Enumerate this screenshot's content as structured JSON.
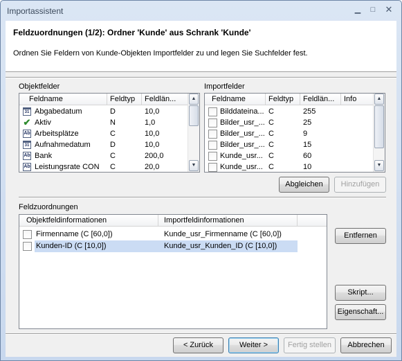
{
  "window": {
    "title": "Importassistent",
    "minimize_icon": "minimize-icon",
    "maximize_icon": "maximize-icon",
    "close_icon": "close-icon"
  },
  "header": {
    "title": "Feldzuordnungen (1/2): Ordner 'Kunde' aus Schrank 'Kunde'",
    "subtitle": "Ordnen Sie Feldern von Kunde-Objekten Importfelder zu und legen Sie Suchfelder fest."
  },
  "objektfelder": {
    "label": "Objektfelder",
    "columns": [
      "Feldname",
      "Feldtyp",
      "Feldlän..."
    ],
    "rows": [
      {
        "icon": "calendar-icon",
        "name": "Abgabedatum",
        "type": "D",
        "length": "10,0"
      },
      {
        "icon": "checkmark-icon",
        "name": "Aktiv",
        "type": "N",
        "length": "1,0"
      },
      {
        "icon": "text-field-icon",
        "name": "Arbeitsplätze",
        "type": "C",
        "length": "10,0"
      },
      {
        "icon": "calendar-icon",
        "name": "Aufnahmedatum",
        "type": "D",
        "length": "10,0"
      },
      {
        "icon": "text-field-icon",
        "name": "Bank",
        "type": "C",
        "length": "200,0"
      },
      {
        "icon": "text-field-icon",
        "name": "Leistungsrate CON",
        "type": "C",
        "length": "20,0"
      }
    ]
  },
  "importfelder": {
    "label": "Importfelder",
    "columns": [
      "Feldname",
      "Feldtyp",
      "Feldlän...",
      "Info"
    ],
    "rows": [
      {
        "name": "Bilddateina...",
        "type": "C",
        "length": "255"
      },
      {
        "name": "Bilder_usr_...",
        "type": "C",
        "length": "25"
      },
      {
        "name": "Bilder_usr_...",
        "type": "C",
        "length": "9"
      },
      {
        "name": "Bilder_usr_...",
        "type": "C",
        "length": "15"
      },
      {
        "name": "Kunde_usr...",
        "type": "C",
        "length": "60"
      },
      {
        "name": "Kunde_usr...",
        "type": "C",
        "length": "10"
      }
    ]
  },
  "buttons": {
    "abgleichen": "Abgleichen",
    "hinzufuegen": "Hinzufügen",
    "entfernen": "Entfernen",
    "skript": "Skript...",
    "eigenschaften": "Eigenschaft...",
    "zurueck": "< Zurück",
    "weiter": "Weiter >",
    "fertig": "Fertig stellen",
    "abbrechen": "Abbrechen"
  },
  "feldzuordnungen": {
    "label": "Feldzuordnungen",
    "columns": [
      "Objektfeldinformationen",
      "Importfeldinformationen"
    ],
    "rows": [
      {
        "object": "Firmenname (C [60,0])",
        "import": "Kunde_usr_Firmenname (C [60,0])",
        "selected": false
      },
      {
        "object": "Kunden-ID (C [10,0])",
        "import": "Kunde_usr_Kunden_ID (C [10,0])",
        "selected": true
      }
    ]
  },
  "colors": {
    "selection": "#cbdcf4",
    "window_frame": "#c8d8ee",
    "dialog_bg": "#f0f0f0"
  }
}
